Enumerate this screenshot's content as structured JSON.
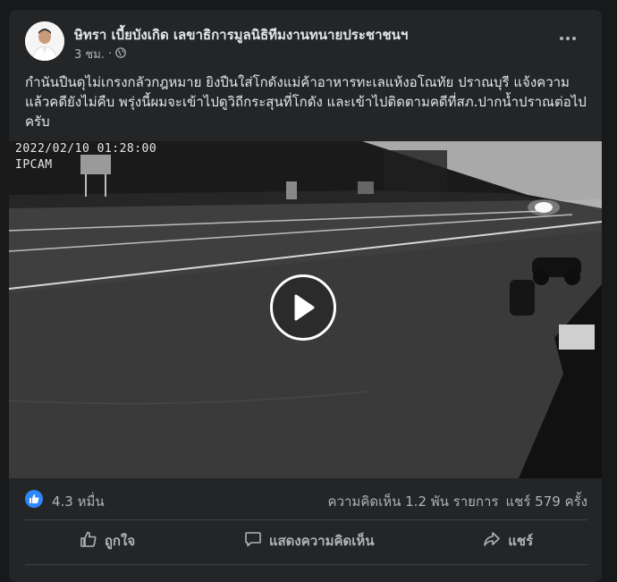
{
  "post": {
    "author": "ษิทรา เบี้ยบังเกิด เลขาธิการมูลนิธิทีมงานทนายประชาชนฯ",
    "time": "3 ชม.",
    "separator": "·",
    "text": "กำนันปืนดุไม่เกรงกลัวกฎหมาย ยิงปืนใส่โกดังแม่ค้าอาหารทะเลแห้งอโณทัย ปราณบุรี แจ้งความแล้วคดียังไม่คืบ พรุ่งนี้ผมจะเข้าไปดูวิถีกระสุนที่โกดัง และเข้าไปติดตามคดีที่สภ.ปากน้ำปราณต่อไปครับ"
  },
  "video": {
    "timestamp": "2022/02/10 01:28:00",
    "camera_label": "IPCAM"
  },
  "stats": {
    "reactions": "4.3 หมื่น",
    "comments": "ความคิดเห็น 1.2 พัน รายการ",
    "shares": "แชร์ 579 ครั้ง"
  },
  "actions": {
    "like": "ถูกใจ",
    "comment": "แสดงความคิดเห็น",
    "share": "แชร์"
  },
  "colors": {
    "background": "#18191a",
    "card": "#242526",
    "text_primary": "#e4e6eb",
    "text_secondary": "#b0b3b8",
    "like_blue": "#2d88ff"
  },
  "icons": [
    "more-options-icon",
    "globe-icon",
    "play-icon",
    "like-reaction-icon",
    "thumbs-up-icon",
    "comment-icon",
    "share-icon"
  ]
}
